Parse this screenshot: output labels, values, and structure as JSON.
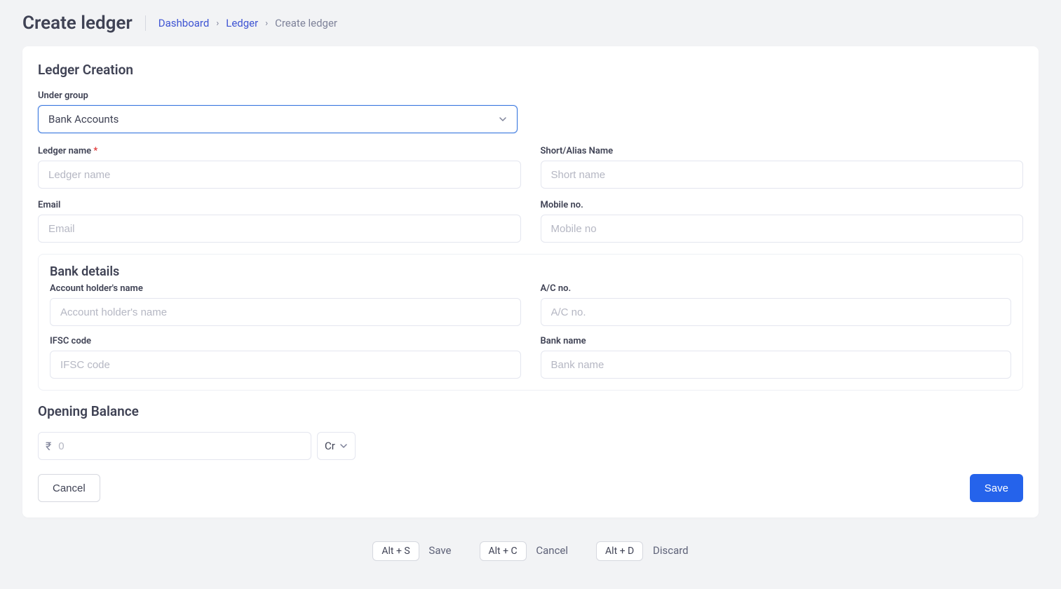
{
  "header": {
    "title": "Create ledger",
    "breadcrumb": {
      "items": [
        {
          "label": "Dashboard",
          "link": true
        },
        {
          "label": "Ledger",
          "link": true
        },
        {
          "label": "Create ledger",
          "link": false
        }
      ]
    }
  },
  "form": {
    "section_title": "Ledger Creation",
    "under_group": {
      "label": "Under group",
      "value": "Bank Accounts"
    },
    "ledger_name": {
      "label": "Ledger name",
      "placeholder": "Ledger name",
      "required": true,
      "value": ""
    },
    "short_name": {
      "label": "Short/Alias Name",
      "placeholder": "Short name",
      "value": ""
    },
    "email": {
      "label": "Email",
      "placeholder": "Email",
      "value": ""
    },
    "mobile": {
      "label": "Mobile no.",
      "placeholder": "Mobile no",
      "value": ""
    },
    "bank": {
      "title": "Bank details",
      "holder": {
        "label": "Account holder's name",
        "placeholder": "Account holder's name",
        "value": ""
      },
      "acno": {
        "label": "A/C no.",
        "placeholder": "A/C no.",
        "value": ""
      },
      "ifsc": {
        "label": "IFSC code",
        "placeholder": "IFSC code",
        "value": ""
      },
      "bank_name": {
        "label": "Bank name",
        "placeholder": "Bank name",
        "value": ""
      }
    },
    "opening_balance": {
      "title": "Opening Balance",
      "currency_symbol": "₹",
      "placeholder": "0",
      "value": "",
      "drcr": "Cr"
    },
    "buttons": {
      "cancel": "Cancel",
      "save": "Save"
    }
  },
  "shortcuts": [
    {
      "key": "Alt + S",
      "label": "Save"
    },
    {
      "key": "Alt + C",
      "label": "Cancel"
    },
    {
      "key": "Alt + D",
      "label": "Discard"
    }
  ]
}
